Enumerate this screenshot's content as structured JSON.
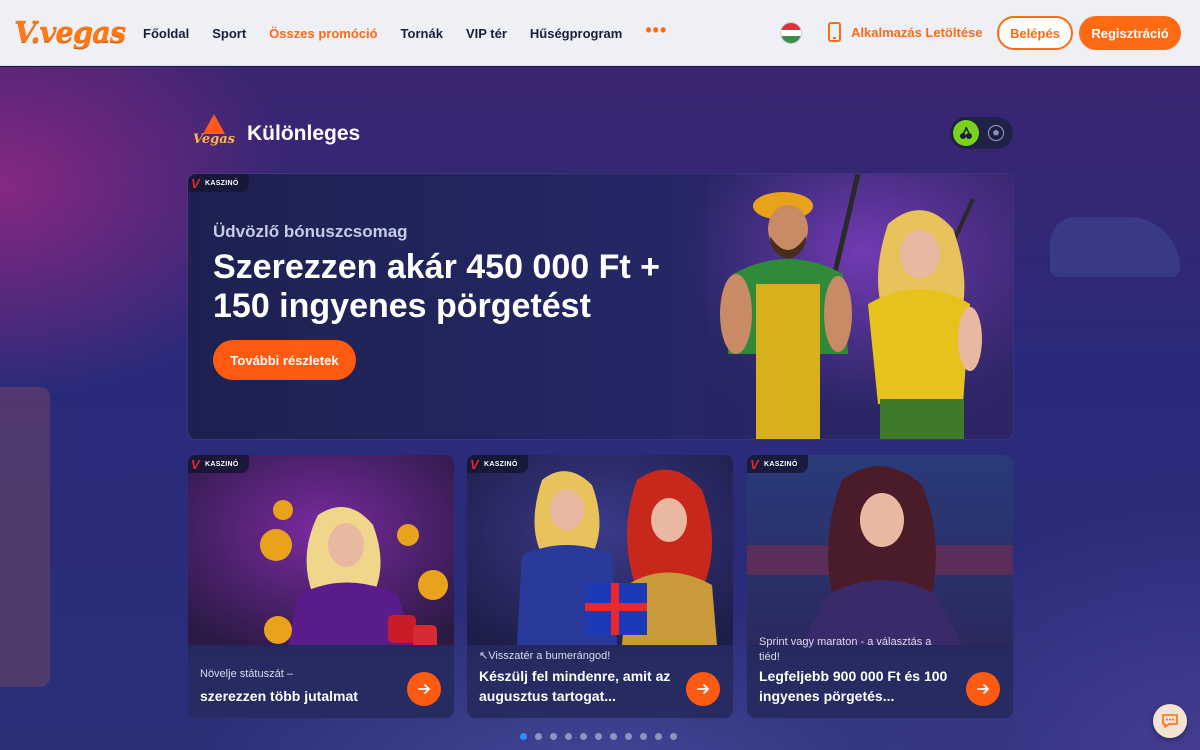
{
  "header": {
    "logo_text": "V.vegas",
    "nav": [
      {
        "label": "Főoldal",
        "active": false
      },
      {
        "label": "Sport",
        "active": false
      },
      {
        "label": "Összes promóció",
        "active": true
      },
      {
        "label": "Tornák",
        "active": false
      },
      {
        "label": "VIP tér",
        "active": false
      },
      {
        "label": "Hűségprogram",
        "active": false
      }
    ],
    "more_label": "•••",
    "language_flag": "hungary-flag-icon",
    "app_download_label": "Alkalmazás Letöltése",
    "login_label": "Belépés",
    "register_label": "Regisztráció"
  },
  "section": {
    "logo_text": "Vegas",
    "title": "Különleges",
    "toggle_icons": [
      "casino-cherry-icon",
      "sport-football-icon"
    ]
  },
  "hero": {
    "tag": "KASZINÓ",
    "subtitle": "Üdvözlő bónuszcsomag",
    "title": "Szerezzen akár 450 000 Ft + 150 ingyenes pörgetést",
    "button_label": "További részletek"
  },
  "cards": [
    {
      "tag": "KASZINÓ",
      "subtitle": "Növelje státuszát –",
      "title": "szerezzen több jutalmat"
    },
    {
      "tag": "KASZINÓ",
      "subtitle": "↖Visszatér a bumerángod!",
      "title": "Készülj fel mindenre, amit az augusztus tartogat..."
    },
    {
      "tag": "KASZINÓ",
      "subtitle": "Sprint vagy maraton - a választás a tiéd!",
      "title": "Legfeljebb 900 000 Ft és 100 ingyenes pörgetés..."
    }
  ],
  "pagination": {
    "count": 11,
    "active_index": 0
  },
  "colors": {
    "accent": "#ff6a12",
    "header_bg": "#eef0f6",
    "nav_text": "#1b1d3a",
    "dot_active": "#2f8bff",
    "toggle_on": "#7bd21e"
  }
}
